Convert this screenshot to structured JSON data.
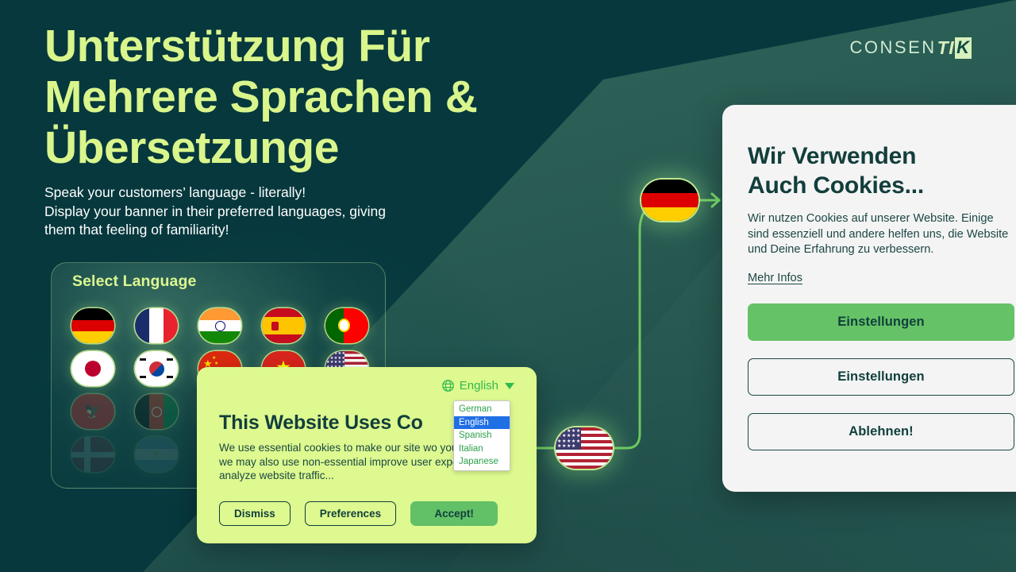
{
  "brand": {
    "logo_part1": "CONSEN",
    "logo_part2": "TI",
    "logo_part3": "K",
    "accent_lime": "#d9f58c",
    "bg_dark": "#06383d",
    "bg_light_wedge": "#2e6157",
    "green_button": "#66c266",
    "banner_bg": "#ddf98f"
  },
  "headline": {
    "title_line1": "Unterstützung Für",
    "title_line2": "Mehrere Sprachen &",
    "title_line3": "Übersetzunge",
    "subtitle_line1": "Speak your customers’ language - literally!",
    "subtitle_line2": "Display your banner in their preferred languages, giving",
    "subtitle_line3": "them that feeling of familiarity!"
  },
  "language_panel": {
    "title": "Select Language",
    "flags": [
      {
        "code": "de",
        "name": "germany-flag",
        "opacity": "full"
      },
      {
        "code": "fr",
        "name": "france-flag",
        "opacity": "full"
      },
      {
        "code": "in",
        "name": "india-flag",
        "opacity": "full"
      },
      {
        "code": "es",
        "name": "spain-flag",
        "opacity": "full"
      },
      {
        "code": "pt",
        "name": "portugal-flag",
        "opacity": "full"
      },
      {
        "code": "jp",
        "name": "japan-flag",
        "opacity": "full"
      },
      {
        "code": "kr",
        "name": "south-korea-flag",
        "opacity": "full"
      },
      {
        "code": "cn",
        "name": "china-flag",
        "opacity": "full"
      },
      {
        "code": "vn",
        "name": "vietnam-flag",
        "opacity": "full"
      },
      {
        "code": "us",
        "name": "usa-flag",
        "opacity": "full"
      },
      {
        "code": "al",
        "name": "albania-flag",
        "opacity": "faded"
      },
      {
        "code": "af",
        "name": "afghanistan-flag",
        "opacity": "faded"
      },
      {
        "code": "x1",
        "name": "flag-hidden-1",
        "opacity": "faded"
      },
      {
        "code": "x2",
        "name": "flag-hidden-2",
        "opacity": "faded"
      },
      {
        "code": "x3",
        "name": "flag-hidden-3",
        "opacity": "faded"
      },
      {
        "code": "dk",
        "name": "denmark-flag",
        "opacity": "ghost"
      },
      {
        "code": "ar",
        "name": "argentina-flag",
        "opacity": "ghost"
      },
      {
        "code": "x4",
        "name": "flag-hidden-4",
        "opacity": "ghost"
      },
      {
        "code": "x5",
        "name": "flag-hidden-5",
        "opacity": "ghost"
      },
      {
        "code": "x6",
        "name": "flag-hidden-6",
        "opacity": "ghost"
      }
    ]
  },
  "cookie_banner_en": {
    "globe_icon": "globe-icon",
    "language_label": "English",
    "caret_icon": "chevron-down-icon",
    "dropdown_options": [
      "German",
      "English",
      "Spanish",
      "Italian",
      "Japanese"
    ],
    "dropdown_selected": "English",
    "heading": "This Website Uses Co",
    "body": "We use essential cookies to make our site wo    your consent, we may also use non-essential   improve user experience and analyze website traffic...",
    "buttons": {
      "dismiss": "Dismiss",
      "preferences": "Preferences",
      "accept": "Accept!"
    }
  },
  "cookie_card_de": {
    "heading_line1": "Wir Verwenden",
    "heading_line2": "Auch Cookies...",
    "body": "Wir nutzen Cookies auf unserer Website. Einige sind essenziell und andere helfen uns, die Website und Deine Erfahrung zu verbessern.",
    "more_link": "Mehr Infos",
    "buttons": {
      "primary": "Einstellungen",
      "secondary": "Einstellungen",
      "reject": "Ablehnen!"
    }
  },
  "connector": {
    "source_flag": "usa-flag",
    "target_flag": "germany-flag",
    "arrow_icon": "arrow-right-icon",
    "line_color": "#6cc65f"
  }
}
